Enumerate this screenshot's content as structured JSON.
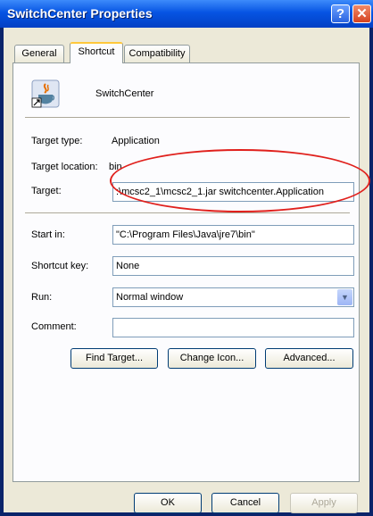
{
  "window": {
    "title": "SwitchCenter Properties",
    "help_glyph": "?",
    "close_glyph": "✕"
  },
  "tabs": [
    {
      "label": "General",
      "active": false
    },
    {
      "label": "Shortcut",
      "active": true
    },
    {
      "label": "Compatibility",
      "active": false
    }
  ],
  "shortcut": {
    "icon": "java-app-icon",
    "name": "SwitchCenter",
    "target_type_label": "Target type:",
    "target_type_value": "Application",
    "target_location_label": "Target location:",
    "target_location_value": "bin",
    "target_label": "Target:",
    "target_value": ":\\mcsc2_1\\mcsc2_1.jar switchcenter.Application",
    "start_in_label": "Start in:",
    "start_in_value": "\"C:\\Program Files\\Java\\jre7\\bin\"",
    "shortcut_key_label": "Shortcut key:",
    "shortcut_key_value": "None",
    "run_label": "Run:",
    "run_value": "Normal window",
    "comment_label": "Comment:",
    "comment_value": "",
    "find_target_label": "Find Target...",
    "change_icon_label": "Change Icon...",
    "advanced_label": "Advanced..."
  },
  "footer": {
    "ok_label": "OK",
    "cancel_label": "Cancel",
    "apply_label": "Apply"
  },
  "colors": {
    "titlebar": "#0654e3",
    "annotation_ellipse": "#e0201c",
    "dialog_bg": "#ece9d8"
  }
}
